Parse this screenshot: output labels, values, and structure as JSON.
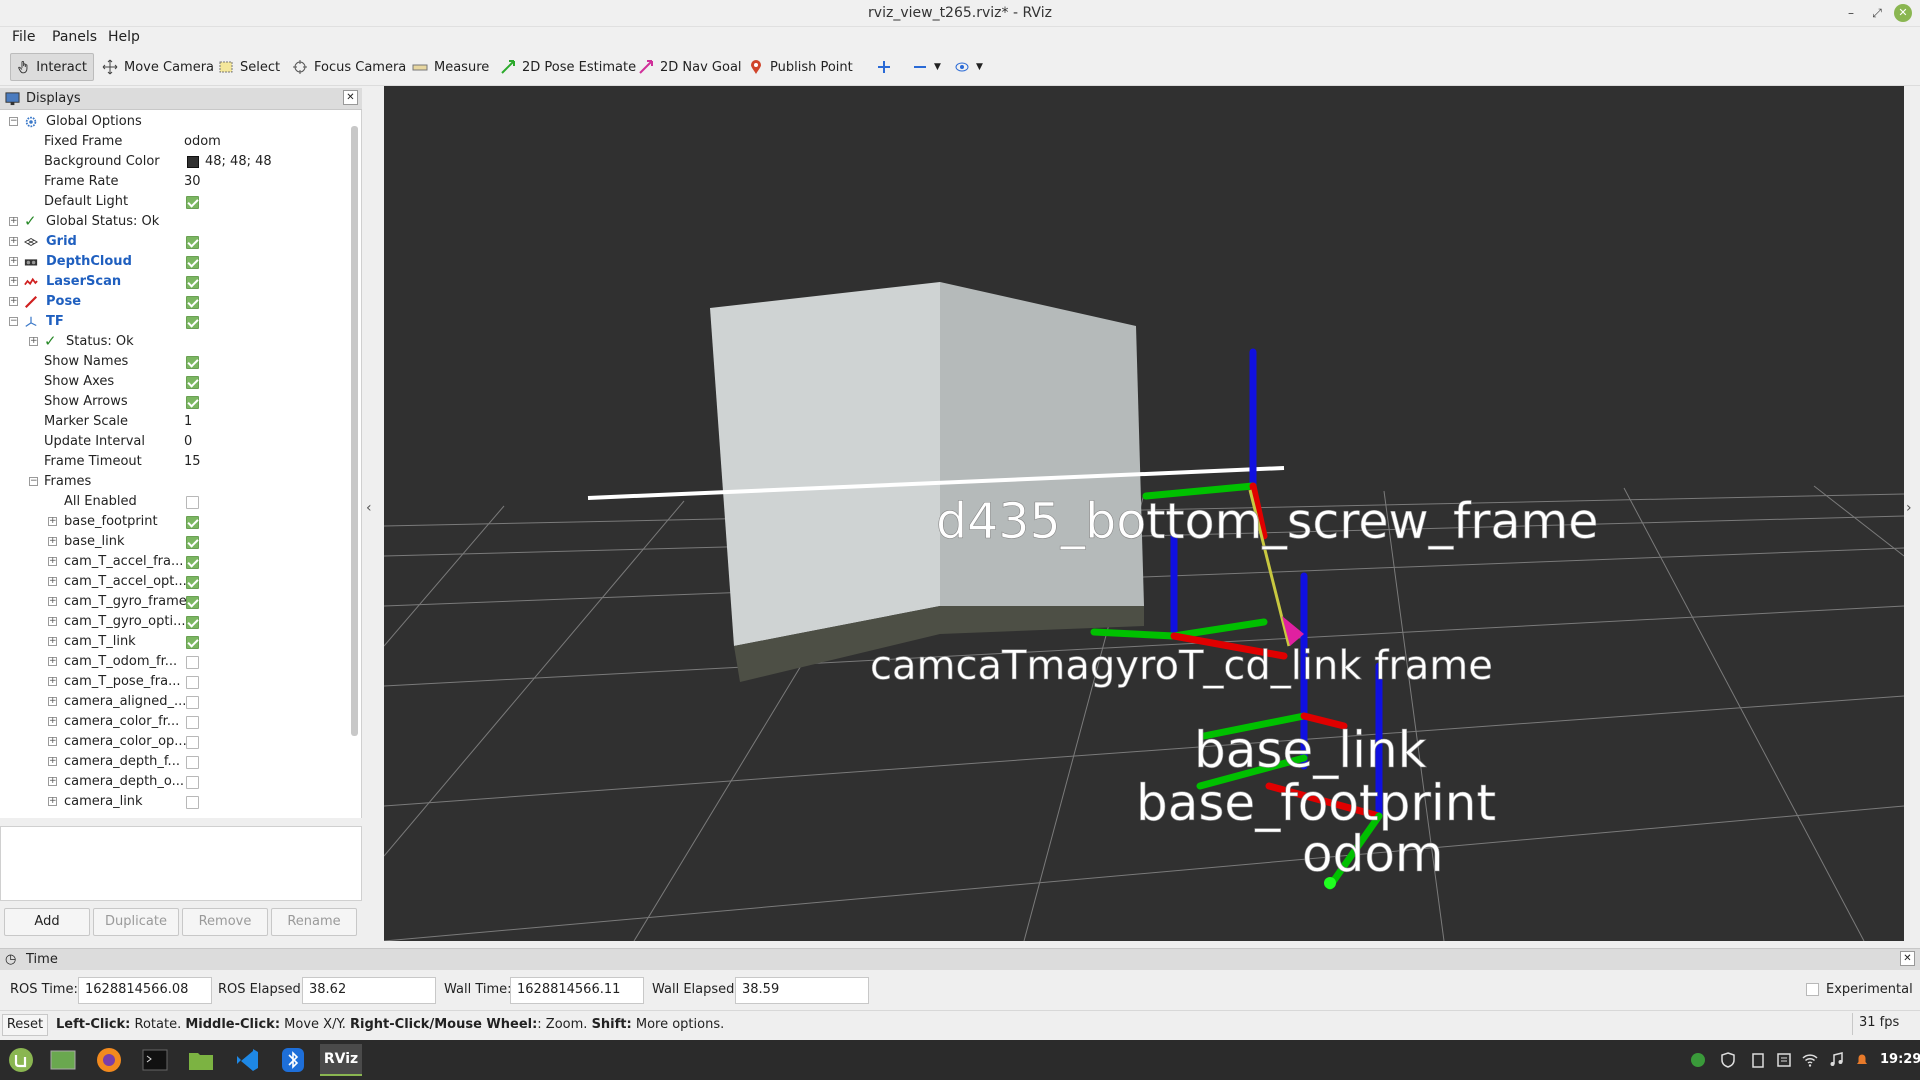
{
  "window": {
    "title": "rviz_view_t265.rviz* - RViz"
  },
  "menubar": {
    "file": "File",
    "panels": "Panels",
    "help": "Help"
  },
  "toolbar": {
    "interact": "Interact",
    "move_camera": "Move Camera",
    "select": "Select",
    "focus_camera": "Focus Camera",
    "measure": "Measure",
    "pose_estimate": "2D Pose Estimate",
    "nav_goal": "2D Nav Goal",
    "publish_point": "Publish Point"
  },
  "displays": {
    "title": "Displays",
    "global_options": "Global Options",
    "fixed_frame_label": "Fixed Frame",
    "fixed_frame_value": "odom",
    "bg_color_label": "Background Color",
    "bg_color_value": "48; 48; 48",
    "frame_rate_label": "Frame Rate",
    "frame_rate_value": "30",
    "default_light_label": "Default Light",
    "global_status": "Global Status: Ok",
    "grid": "Grid",
    "depthcloud": "DepthCloud",
    "laserscan": "LaserScan",
    "pose": "Pose",
    "tf": "TF",
    "tf_status": "Status: Ok",
    "show_names": "Show Names",
    "show_axes": "Show Axes",
    "show_arrows": "Show Arrows",
    "marker_scale_label": "Marker Scale",
    "marker_scale_value": "1",
    "update_interval_label": "Update Interval",
    "update_interval_value": "0",
    "frame_timeout_label": "Frame Timeout",
    "frame_timeout_value": "15",
    "frames": "Frames",
    "all_enabled": "All Enabled",
    "frame_items": [
      {
        "name": "base_footprint",
        "checked": true
      },
      {
        "name": "base_link",
        "checked": true
      },
      {
        "name": "cam_T_accel_fra...",
        "checked": true
      },
      {
        "name": "cam_T_accel_opt...",
        "checked": true
      },
      {
        "name": "cam_T_gyro_frame",
        "checked": true
      },
      {
        "name": "cam_T_gyro_opti...",
        "checked": true
      },
      {
        "name": "cam_T_link",
        "checked": true
      },
      {
        "name": "cam_T_odom_fr...",
        "checked": false
      },
      {
        "name": "cam_T_pose_fra...",
        "checked": false
      },
      {
        "name": "camera_aligned_...",
        "checked": false
      },
      {
        "name": "camera_color_fr...",
        "checked": false
      },
      {
        "name": "camera_color_op...",
        "checked": false
      },
      {
        "name": "camera_depth_f...",
        "checked": false
      },
      {
        "name": "camera_depth_o...",
        "checked": false
      },
      {
        "name": "camera_link",
        "checked": false
      }
    ],
    "buttons": {
      "add": "Add",
      "duplicate": "Duplicate",
      "remove": "Remove",
      "rename": "Rename"
    }
  },
  "viewport": {
    "labels": {
      "d435": "d435_bottom_screw_frame",
      "cam_cluster": "camcaTmagyroT_cd_link frame",
      "base_link": "base_link",
      "base_footprint": "base_footprint",
      "odom": "odom"
    }
  },
  "time": {
    "title": "Time",
    "ros_time_label": "ROS Time:",
    "ros_time_value": "1628814566.08",
    "ros_elapsed_label": "ROS Elapsed:",
    "ros_elapsed_value": "38.62",
    "wall_time_label": "Wall Time:",
    "wall_time_value": "1628814566.11",
    "wall_elapsed_label": "Wall Elapsed:",
    "wall_elapsed_value": "38.59",
    "experimental": "Experimental"
  },
  "status": {
    "reset": "Reset",
    "left_click": "Left-Click:",
    "left_click_desc": " Rotate. ",
    "middle_click": "Middle-Click:",
    "middle_click_desc": " Move X/Y. ",
    "right_click": "Right-Click/Mouse Wheel:",
    "right_click_desc": ": Zoom. ",
    "shift": "Shift:",
    "shift_desc": " More options.",
    "fps": "31 fps"
  },
  "taskbar": {
    "active_app": "RViz",
    "clock": "19:29"
  }
}
